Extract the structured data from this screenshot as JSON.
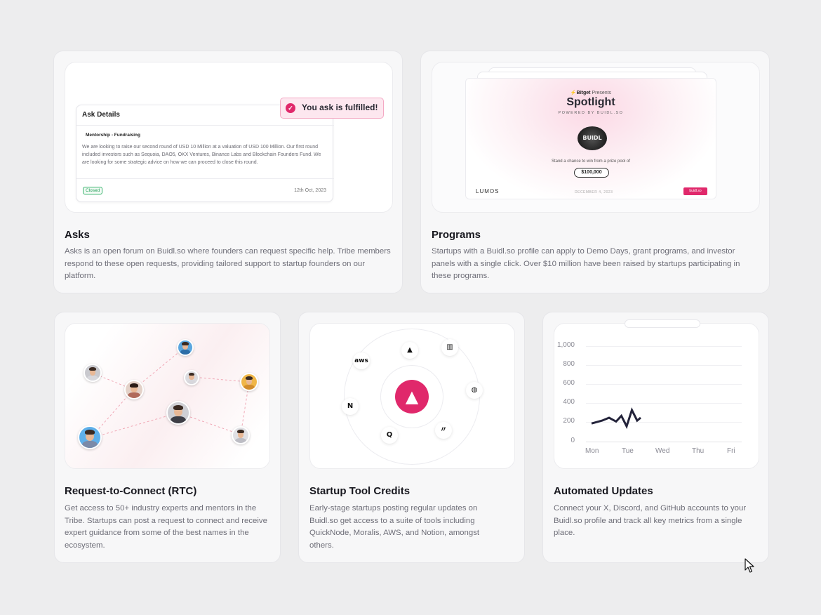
{
  "asks": {
    "preview": {
      "header": "Ask Details",
      "tag": "Mentorship - Fundraising",
      "body": "We are looking to raise our second round of USD 10 Million at a valuation of USD 100 Million. Our first round included investors such as Sequoia, DAO5, OKX Ventures, Binance Labs and Blockchain Founders Fund. We are looking for some strategic advice on how we can proceed to close this round.",
      "status": "Closed",
      "date": "12th Oct, 2023",
      "toast": "You ask is fulfilled!",
      "toast_icon": "check-icon"
    },
    "title": "Asks",
    "description": "Asks is an open forum on Buidl.so where founders can request specific help. Tribe members respond to these open requests, providing tailored support to startup founders on our platform."
  },
  "programs": {
    "preview": {
      "brand": "Bitget",
      "presents": "Presents",
      "event_title": "Spotlight",
      "powered_by": "POWERED BY BUIDL.SO",
      "logo_text": "BUIDL",
      "tagline": "Stand a chance to win from a prize pool of",
      "prize": "$100,000",
      "partner": "LUMOS",
      "date": "DECEMBER 4, 2023",
      "badge": "buidl.so"
    },
    "title": "Programs",
    "description": "Startups with a Buidl.so profile can apply to Demo Days, grant programs, and investor panels with a single click. Over $10 million have been raised by startups participating in these programs."
  },
  "rtc": {
    "title": "Request-to-Connect (RTC)",
    "description": "Get access to 50+ industry experts and mentors in the Tribe. Startups can post a request to connect and receive expert guidance from some of the best names in the ecosystem."
  },
  "tools": {
    "center_icon": "buidl-logo-icon",
    "icons": [
      "aws-icon",
      "alchemy-icon",
      "intercom-icon",
      "notion-icon",
      "quicknode-icon",
      "moralis-icon",
      "chainlink-icon"
    ],
    "aws_label": "aws",
    "title": "Startup Tool Credits",
    "description": "Early-stage startups posting regular updates on Buidl.so get access to a suite of tools including QuickNode, Moralis, AWS, and Notion, amongst others."
  },
  "updates": {
    "title": "Automated Updates",
    "description": "Connect your X, Discord, and GitHub accounts to your Buidl.so profile and track all key metrics from a single place."
  },
  "chart_data": {
    "type": "line",
    "categories": [
      "Mon",
      "Tue",
      "Wed",
      "Thu",
      "Fri"
    ],
    "yticks": [
      "1,000",
      "800",
      "600",
      "400",
      "200",
      "0"
    ],
    "ylim": [
      0,
      1000
    ],
    "series": [
      {
        "color": "#23233a",
        "x": [
          0,
          0.3,
          0.5,
          0.7,
          0.85,
          1.0,
          1.15,
          1.3,
          1.4
        ],
        "y": [
          190,
          220,
          250,
          210,
          270,
          160,
          330,
          220,
          250
        ]
      }
    ],
    "grid": true,
    "legend": "none"
  },
  "colors": {
    "accent": "#e0286b",
    "success": "#1f9d55"
  }
}
